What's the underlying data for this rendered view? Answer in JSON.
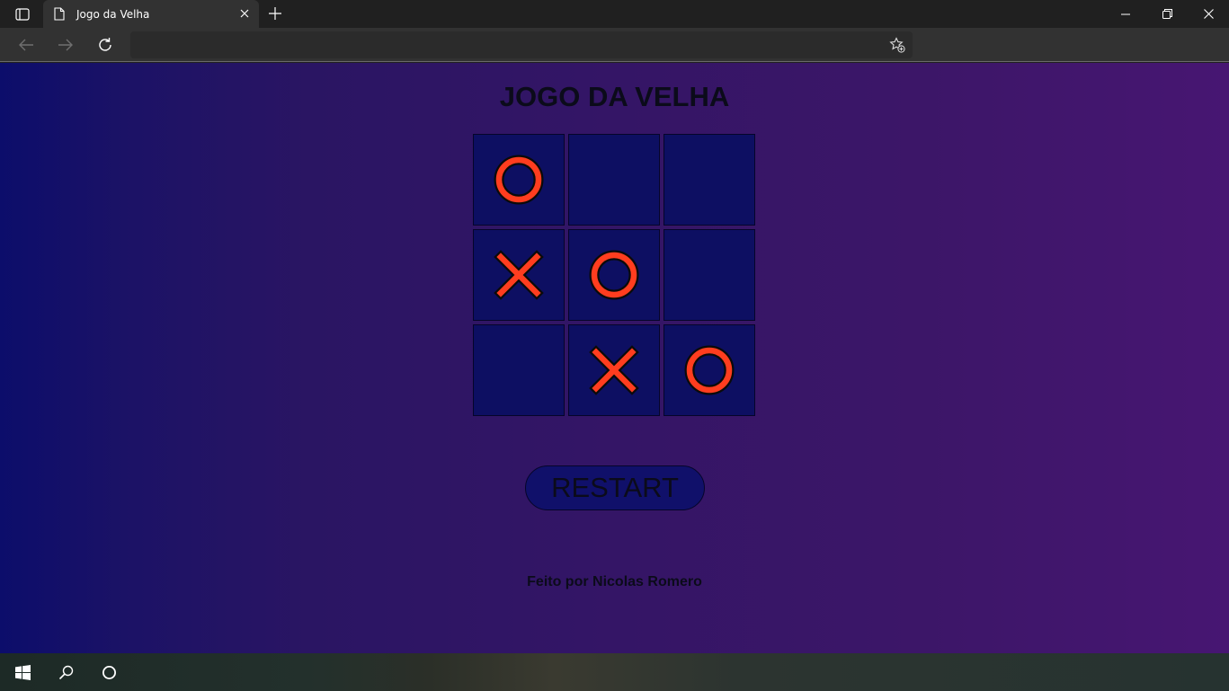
{
  "browser": {
    "tab_title": "Jogo da Velha",
    "address": ""
  },
  "page": {
    "title": "JOGO DA VELHA",
    "board": [
      [
        "O",
        "",
        ""
      ],
      [
        "X",
        "O",
        ""
      ],
      [
        "",
        "X",
        "O"
      ]
    ],
    "restart_label": "RESTART",
    "credit": "Feito por Nicolas Romero"
  },
  "colors": {
    "mark": "#ff3d1f",
    "mark_outline": "#0a0a0a",
    "cell_bg": "#0d0f62"
  },
  "icons": {
    "tab_actions": "tab-actions-icon",
    "page": "page-icon",
    "close": "close-icon",
    "new_tab": "plus-icon",
    "back": "back-arrow-icon",
    "forward": "forward-arrow-icon",
    "refresh": "refresh-icon",
    "favorite": "add-favorite-icon",
    "start": "windows-logo-icon",
    "search": "search-icon",
    "cortana": "cortana-icon"
  }
}
